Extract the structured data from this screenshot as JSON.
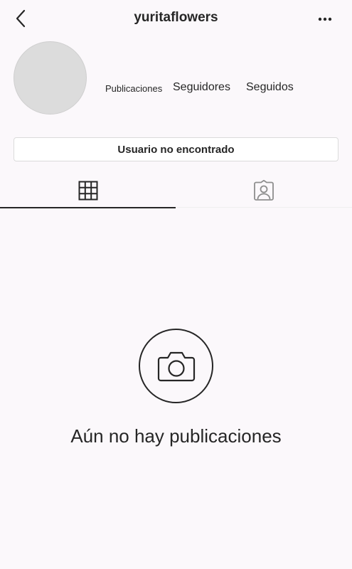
{
  "header": {
    "username": "yuritaflowers",
    "back_icon": "chevron-left-icon",
    "more_icon": "more-horizontal-icon"
  },
  "profile": {
    "posts_label": "Publicaciones",
    "followers_label": "Seguidores",
    "following_label": "Seguidos"
  },
  "actions": {
    "user_not_found_label": "Usuario no encontrado"
  },
  "tabs": [
    {
      "name": "grid",
      "icon": "grid-icon",
      "active": true
    },
    {
      "name": "tagged",
      "icon": "tagged-user-icon",
      "active": false
    }
  ],
  "empty_state": {
    "icon": "camera-icon",
    "message": "Aún no hay publicaciones"
  },
  "colors": {
    "background": "#fbf8fb",
    "text": "#262626",
    "avatar_placeholder": "#dcdcdc",
    "border": "#dbdbdb"
  }
}
